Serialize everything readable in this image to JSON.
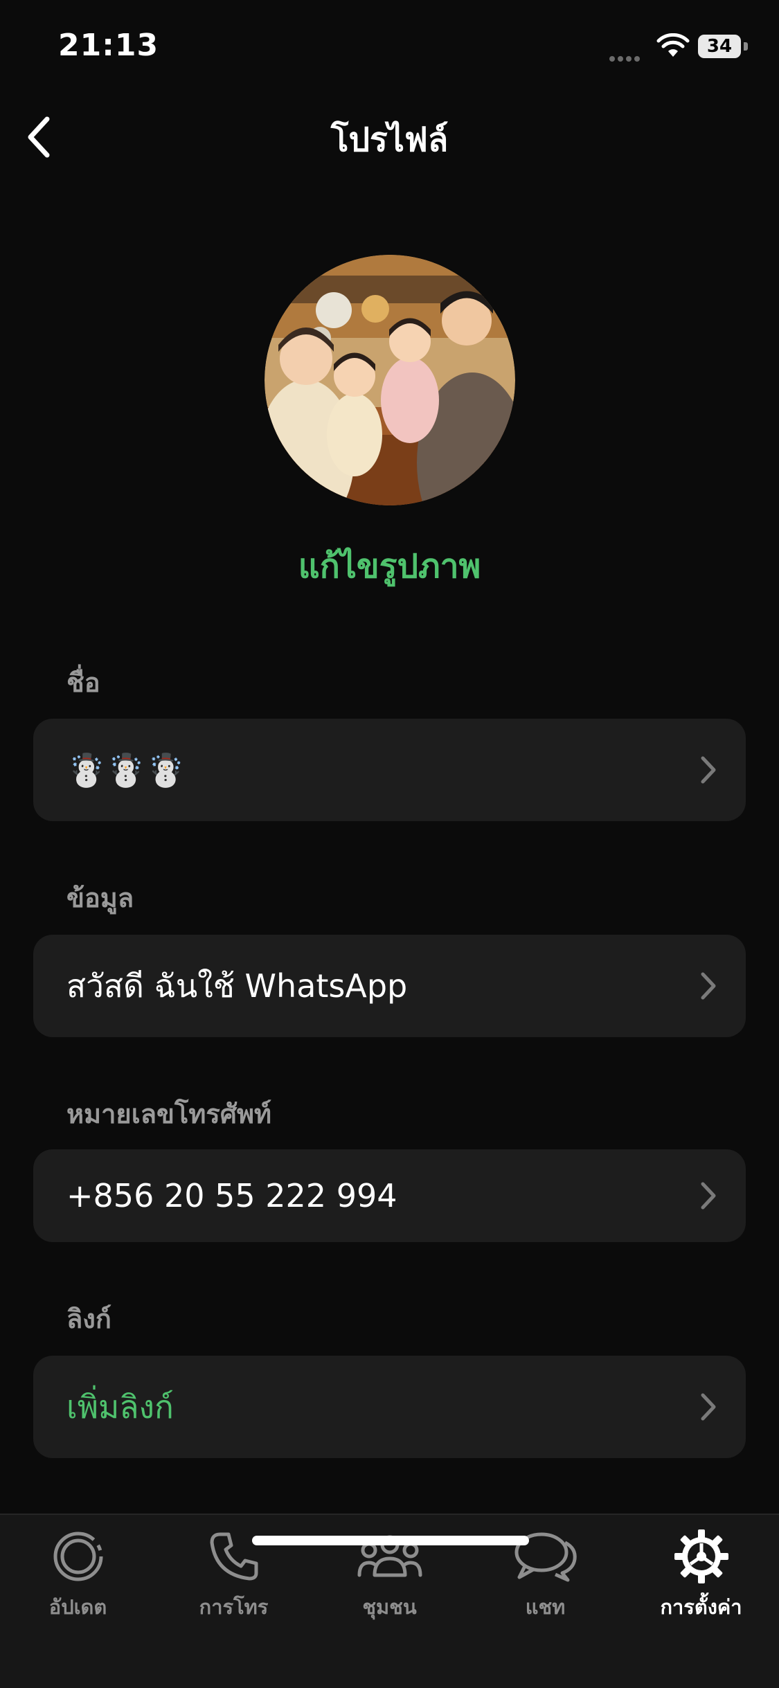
{
  "status_bar": {
    "time": "21:13",
    "battery": "34"
  },
  "header": {
    "title": "โปรไฟล์"
  },
  "profile": {
    "edit_photo_label": "แก้ไขรูปภาพ"
  },
  "sections": {
    "name": {
      "label": "ชื่อ",
      "value": "☃️☃️☃️"
    },
    "about": {
      "label": "ข้อมูล",
      "value": "สวัสดี ฉันใช้ WhatsApp"
    },
    "phone": {
      "label": "หมายเลขโทรศัพท์",
      "value": "+856 20 55 222 994"
    },
    "links": {
      "label": "ลิงก์",
      "value": "เพิ่มลิงก์"
    }
  },
  "tabbar": {
    "items": [
      {
        "label": "อัปเดต",
        "icon": "updates-icon",
        "active": false
      },
      {
        "label": "การโทร",
        "icon": "phone-icon",
        "active": false
      },
      {
        "label": "ชุมชน",
        "icon": "communities-icon",
        "active": false
      },
      {
        "label": "แชท",
        "icon": "chats-icon",
        "active": false
      },
      {
        "label": "การตั้งค่า",
        "icon": "settings-icon",
        "active": true
      }
    ]
  },
  "colors": {
    "accent": "#4fc26d",
    "background": "#0b0b0b",
    "row": "#1d1d1d"
  }
}
